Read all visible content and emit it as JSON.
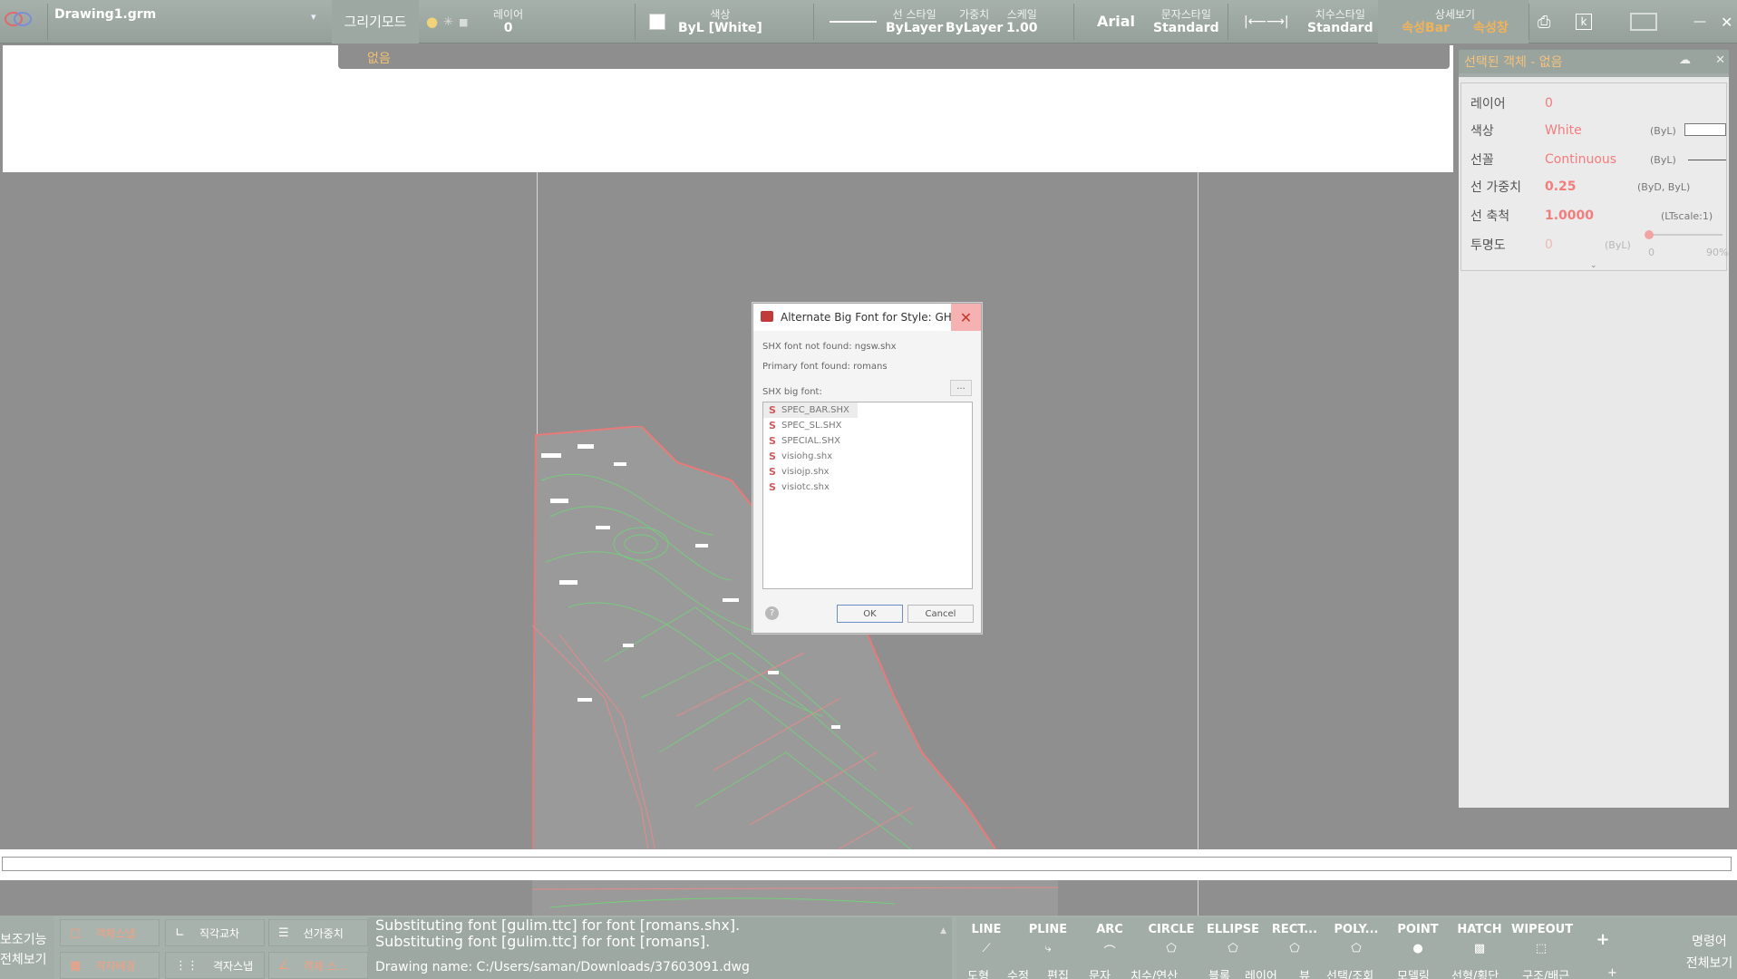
{
  "top": {
    "doc_title": "Drawing1.grm",
    "mode_label": "그리기모드",
    "layer_label": "레이어",
    "layer_value": "0",
    "color_label": "색상",
    "color_value": "ByL [White]",
    "linestyle_label": "선 스타일",
    "linestyle_value": "ByLayer",
    "weight_label": "가중치",
    "weight_value": "ByLayer",
    "scale_label": "스케일",
    "scale_value": "1.00",
    "font_value": "Arial",
    "textstyle_label": "문자스타일",
    "textstyle_value": "Standard",
    "dimstyle_label": "치수스타일",
    "dimstyle_value": "Standard",
    "detail_label": "상세보기",
    "propbar_label": "속성Bar",
    "propwin_label": "속성창",
    "k_label": "k"
  },
  "subbar": {
    "label": "없음"
  },
  "panel": {
    "title": "선택된 객체 - 없음",
    "rows": [
      {
        "key": "레이어",
        "value": "0",
        "meta": ""
      },
      {
        "key": "색상",
        "value": "White",
        "meta": "(ByL)"
      },
      {
        "key": "선꼴",
        "value": "Continuous",
        "meta": "(ByL)"
      },
      {
        "key": "선 가중치",
        "value": "0.25",
        "meta": "(ByD, ByL)"
      },
      {
        "key": "선 축척",
        "value": "1.0000",
        "meta": "(LTscale:1)"
      },
      {
        "key": "투명도",
        "value": "0",
        "meta": "(ByL)"
      }
    ],
    "transparency_min": "0",
    "transparency_max": "90",
    "transparency_unit": "%"
  },
  "dialog": {
    "title": "Alternate Big Font for Style: GHS...",
    "line1": "SHX font not found: ngsw.shx",
    "line2": "Primary font found: romans",
    "list_label": "SHX big font:",
    "browse_label": "...",
    "items": [
      "SPEC_BAR.SHX",
      "SPEC_SL.SHX",
      "SPECIAL.SHX",
      "visiohg.shx",
      "visiojp.shx",
      "visiotc.shx"
    ],
    "ok_label": "OK",
    "cancel_label": "Cancel",
    "help_label": "?"
  },
  "bottom": {
    "aux_label": "보조기능",
    "fullview_label": "전체보기",
    "buttons": [
      {
        "label": "객체스냅",
        "icon": "□"
      },
      {
        "label": "직각교차",
        "icon": "∟"
      },
      {
        "label": "선가중치",
        "icon": "☰"
      },
      {
        "label": "격자배경",
        "icon": "▦"
      },
      {
        "label": "격자스냅",
        "icon": "⋮⋮"
      },
      {
        "label": "객체 스...",
        "icon": "∠"
      }
    ],
    "log": [
      "Substituting font [gulim.ttc] for font [romans.shx].",
      "Substituting font [gulim.ttc] for font [romans].",
      "Drawing name: C:/Users/saman/Downloads/37603091.dwg"
    ],
    "tools": [
      {
        "label": "LINE",
        "icon": "⟋"
      },
      {
        "label": "PLINE",
        "icon": "⤷"
      },
      {
        "label": "ARC",
        "icon": "⌒"
      },
      {
        "label": "CIRCLE",
        "icon": "⬠"
      },
      {
        "label": "ELLIPSE",
        "icon": "⬠"
      },
      {
        "label": "RECT...",
        "icon": "⬠"
      },
      {
        "label": "POLY...",
        "icon": "⬠"
      },
      {
        "label": "POINT",
        "icon": "●"
      },
      {
        "label": "HATCH",
        "icon": "▩"
      },
      {
        "label": "WIPEOUT",
        "icon": "⬚"
      }
    ],
    "plus_label": "+",
    "tabs": [
      "도형",
      "수정",
      "편집",
      "문자",
      "치수/연산",
      "블록",
      "레이어",
      "뷰",
      "선택/조회",
      "모델링",
      "선형/횡단",
      "구조/배근",
      "+"
    ],
    "cmd_label": "명령어",
    "cmd_fullview": "전체보기"
  },
  "colors": {
    "accent": "#f0b35a",
    "panel_value": "#f37c7c",
    "toolbar": "#a7b1ac"
  }
}
